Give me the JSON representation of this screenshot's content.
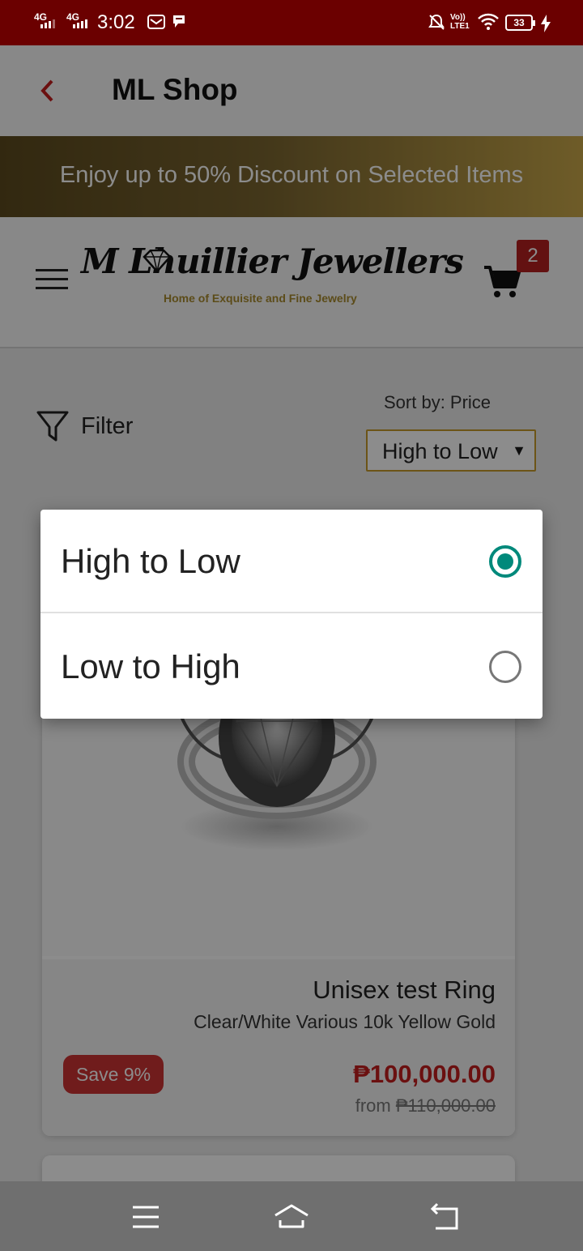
{
  "status": {
    "time": "3:02",
    "net1": "4G",
    "net2": "4G",
    "volte": "Vo)) LTE1",
    "battery": "33"
  },
  "appbar": {
    "title": "ML Shop"
  },
  "promo": {
    "text": "Enjoy up to 50% Discount on Selected Items"
  },
  "brand": {
    "name": "M Lhuillier Jewellers",
    "tagline": "Home of Exquisite and Fine Jewelry"
  },
  "cart": {
    "count": "2"
  },
  "toolbar": {
    "filter_label": "Filter",
    "sort_label": "Sort by: Price",
    "sort_selected": "High to Low"
  },
  "product": {
    "name": "Unisex test Ring",
    "variant": "Clear/White Various 10k Yellow Gold",
    "save_badge": "Save 9%",
    "price": "₱100,000.00",
    "from_label": "from",
    "original_price": "₱110,000.00"
  },
  "sort_dialog": {
    "options": [
      {
        "label": "High to Low",
        "selected": true
      },
      {
        "label": "Low to High",
        "selected": false
      }
    ]
  },
  "colors": {
    "status_bar": "#6b0000",
    "accent_red": "#c31e1e",
    "gold": "#c59a2b",
    "radio_selected": "#00897b"
  }
}
